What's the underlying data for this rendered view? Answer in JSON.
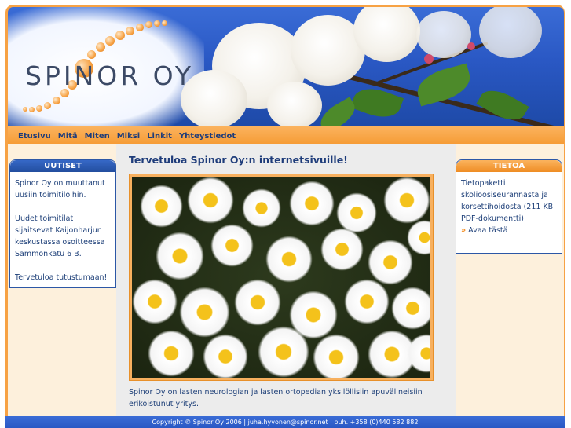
{
  "logo": {
    "text": "SPINOR OY"
  },
  "nav": {
    "items": [
      {
        "label": "Etusivu"
      },
      {
        "label": "Mitä"
      },
      {
        "label": "Miten"
      },
      {
        "label": "Miksi"
      },
      {
        "label": "Linkit"
      },
      {
        "label": "Yhteystiedot"
      }
    ]
  },
  "news_box": {
    "title": "UUTISET",
    "paragraphs": [
      "Spinor Oy on muuttanut uusiin toimitiloihin.",
      "Uudet toimitilat sijaitsevat Kaijonharjun keskustassa osoitteessa Sammonkatu 6 B.",
      "Tervetuloa tutustumaan!"
    ]
  },
  "main": {
    "title": "Tervetuloa Spinor Oy:n internetsivuille!",
    "description": "Spinor Oy on lasten neurologian ja lasten ortopedian yksilöllisiin apuvälineisiin erikoistunut yritys."
  },
  "info_box": {
    "title": "TIETOA",
    "text": "Tietopaketti skolioosiseurannasta ja korsettihoidosta (211 KB PDF-dokumentti)",
    "link_arrow": "»",
    "link_label": "Avaa tästä"
  },
  "footer": {
    "text": "Copyright © Spinor Oy 2006   |   juha.hyvonen@spinor.net   |   puh. +358 (0)440 582 882"
  },
  "colors": {
    "accent_orange": "#f7a244",
    "brand_blue": "#2a58c4",
    "text_blue": "#1d3f78"
  }
}
